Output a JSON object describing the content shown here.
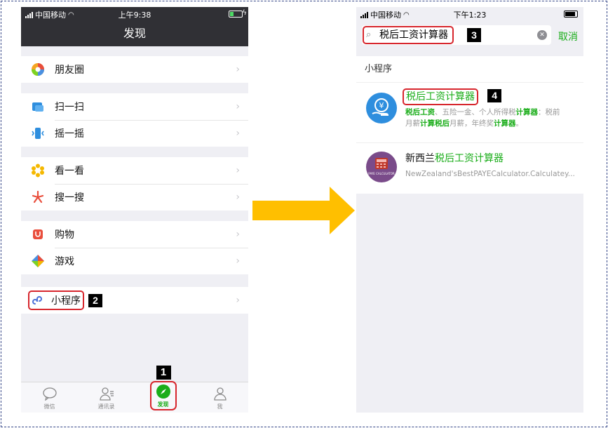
{
  "left_phone": {
    "status": {
      "carrier": "中国移动",
      "time": "上午9:38"
    },
    "title": "发现",
    "groups": [
      [
        {
          "label": "朋友圈",
          "icon": "moments-icon"
        }
      ],
      [
        {
          "label": "扫一扫",
          "icon": "scan-icon"
        },
        {
          "label": "摇一摇",
          "icon": "shake-icon"
        }
      ],
      [
        {
          "label": "看一看",
          "icon": "top-stories-icon"
        },
        {
          "label": "搜一搜",
          "icon": "search-icon"
        }
      ],
      [
        {
          "label": "购物",
          "icon": "shopping-icon"
        },
        {
          "label": "游戏",
          "icon": "games-icon"
        }
      ],
      [
        {
          "label": "小程序",
          "icon": "mini-program-icon"
        }
      ]
    ],
    "step_badge_mini_program": "2",
    "step_badge_discover_tab": "1",
    "tabs": [
      {
        "label": "微信",
        "icon": "chat-icon"
      },
      {
        "label": "通讯录",
        "icon": "contacts-icon"
      },
      {
        "label": "发现",
        "icon": "discover-compass-icon",
        "active": true
      },
      {
        "label": "我",
        "icon": "me-icon"
      }
    ]
  },
  "right_phone": {
    "status": {
      "carrier": "中国移动",
      "time": "下午1:23"
    },
    "search": {
      "query": "税后工资计算器",
      "cancel_label": "取消",
      "step_badge": "3"
    },
    "section_header": "小程序",
    "results": [
      {
        "name": "税后工资计算器",
        "step_badge": "4",
        "desc_segments": [
          {
            "t": "税后工资",
            "hl": true
          },
          {
            "t": "、五险一金、个人所得税",
            "hl": false
          },
          {
            "t": "计算器",
            "hl": true
          },
          {
            "t": "：税前",
            "hl": false
          }
        ],
        "desc_segments_2": [
          {
            "t": "月薪",
            "hl": false
          },
          {
            "t": "计算税后",
            "hl": true
          },
          {
            "t": "月薪，年终奖",
            "hl": false
          },
          {
            "t": "计算器",
            "hl": true
          },
          {
            "t": "。",
            "hl": false
          }
        ],
        "icon": "yen-hand-icon",
        "icon_color": "#2e8ede"
      },
      {
        "name_prefix": "新西兰",
        "name_highlight": "税后工资计算器",
        "desc": "NewZealand'sBestPAYECalculator.Calculatey...",
        "icon": "paye-calculator-icon",
        "icon_label": "PAYE CALCULATOR",
        "icon_color": "#7a4b8a"
      }
    ]
  },
  "colors": {
    "accent_green": "#1aad19",
    "highlight_red": "#d7262d",
    "arrow": "#ffbf00",
    "dark_header": "#303035"
  }
}
